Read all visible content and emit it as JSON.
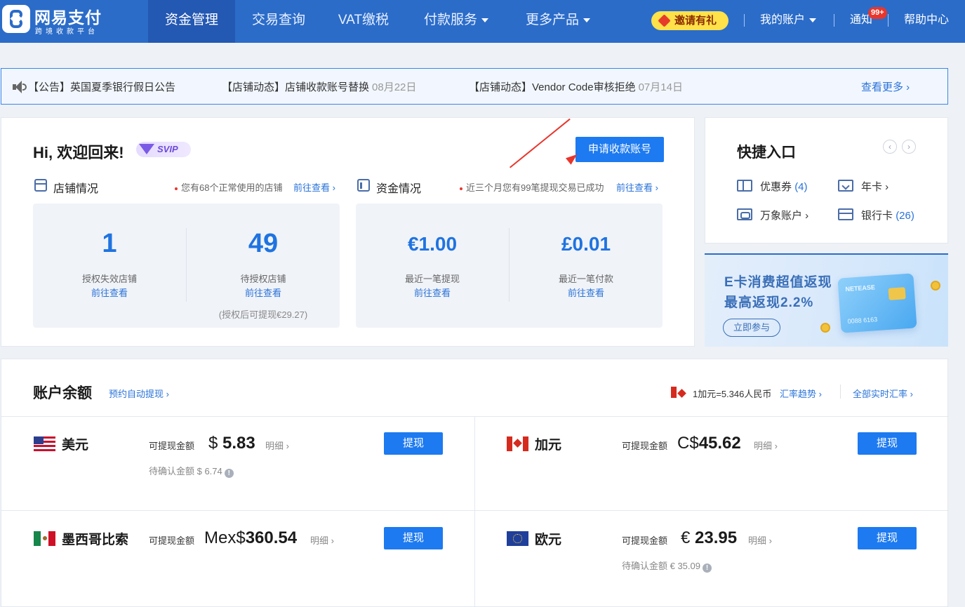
{
  "brand": {
    "name": "网易支付",
    "tagline": "跨境收款平台"
  },
  "nav": {
    "items": [
      {
        "label": "资金管理",
        "active": true
      },
      {
        "label": "交易查询"
      },
      {
        "label": "VAT缴税"
      },
      {
        "label": "付款服务",
        "dropdown": true
      },
      {
        "label": "更多产品",
        "dropdown": true
      }
    ],
    "invite": "邀请有礼",
    "account": "我的账户",
    "notify": "通知",
    "notify_badge": "99+",
    "help": "帮助中心"
  },
  "announcements": {
    "items": [
      {
        "text": "【公告】英国夏季银行假日公告",
        "date": ""
      },
      {
        "text": "【店铺动态】店铺收款账号替换",
        "date": "08月22日"
      },
      {
        "text": "【店铺动态】Vendor Code审核拒绝",
        "date": "07月14日"
      }
    ],
    "more": "查看更多 ›"
  },
  "welcome": {
    "greeting": "Hi, 欢迎回来!",
    "badge": "SVIP",
    "apply_button": "申请收款账号",
    "store": {
      "title": "店铺情况",
      "note": "您有68个正常使用的店铺",
      "link": "前往查看 ›",
      "stats": [
        {
          "value": "1",
          "label": "授权失效店铺",
          "link": "前往查看"
        },
        {
          "value": "49",
          "label": "待授权店铺",
          "link": "前往查看",
          "note": "(授权后可提现€29.27)"
        }
      ]
    },
    "funds": {
      "title": "资金情况",
      "note": "近三个月您有99笔提现交易已成功",
      "link": "前往查看 ›",
      "stats": [
        {
          "value": "€1.00",
          "label": "最近一笔提现",
          "link": "前往查看"
        },
        {
          "value": "£0.01",
          "label": "最近一笔付款",
          "link": "前往查看"
        }
      ]
    }
  },
  "quick": {
    "title": "快捷入口",
    "prev": "‹",
    "next": "›",
    "items": [
      {
        "label": "优惠券",
        "count": "(4)",
        "icon": "coupon-icon"
      },
      {
        "label": "年卡 ›",
        "count": "",
        "icon": "card-icon"
      },
      {
        "label": "万象账户 ›",
        "count": "",
        "icon": "wanxiang-icon"
      },
      {
        "label": "银行卡",
        "count": "(26)",
        "icon": "bank-card-icon"
      }
    ]
  },
  "promo": {
    "line1": "E卡消费超值返现",
    "line2": "最高返现2.2%",
    "button": "立即参与",
    "card_brand": "NETEASE",
    "card_number": "0088 6163"
  },
  "balance": {
    "title": "账户余额",
    "auto_withdraw": "预约自动提现 ›",
    "rate_text": "1加元=5.346人民币",
    "rate_trend": "汇率趋势 ›",
    "rate_all": "全部实时汇率 ›",
    "currencies": [
      {
        "name": "美元",
        "flag": "us-flag-icon",
        "label": "可提现金额",
        "symbol": "$ ",
        "amount": "5.83",
        "detail": "明细 ›",
        "pending": "待确认金额 $ 6.74",
        "button": "提现"
      },
      {
        "name": "加元",
        "flag": "ca-flag-icon",
        "label": "可提现金额",
        "symbol": "C$",
        "amount": "45.62",
        "detail": "明细 ›",
        "pending": "",
        "button": "提现"
      },
      {
        "name": "墨西哥比索",
        "flag": "mx-flag-icon",
        "label": "可提现金额",
        "symbol": "Mex$",
        "amount": "360.54",
        "detail": "明细 ›",
        "pending": "",
        "button": "提现"
      },
      {
        "name": "欧元",
        "flag": "eu-flag-icon",
        "label": "可提现金额",
        "symbol": "€ ",
        "amount": "23.95",
        "detail": "明细 ›",
        "pending": "待确认金额 € 35.09",
        "button": "提现"
      }
    ]
  },
  "colors": {
    "primary": "#1d7af0",
    "nav_bg": "#2b6cc9",
    "link": "#2a73d9",
    "accent_red": "#e8362d"
  }
}
